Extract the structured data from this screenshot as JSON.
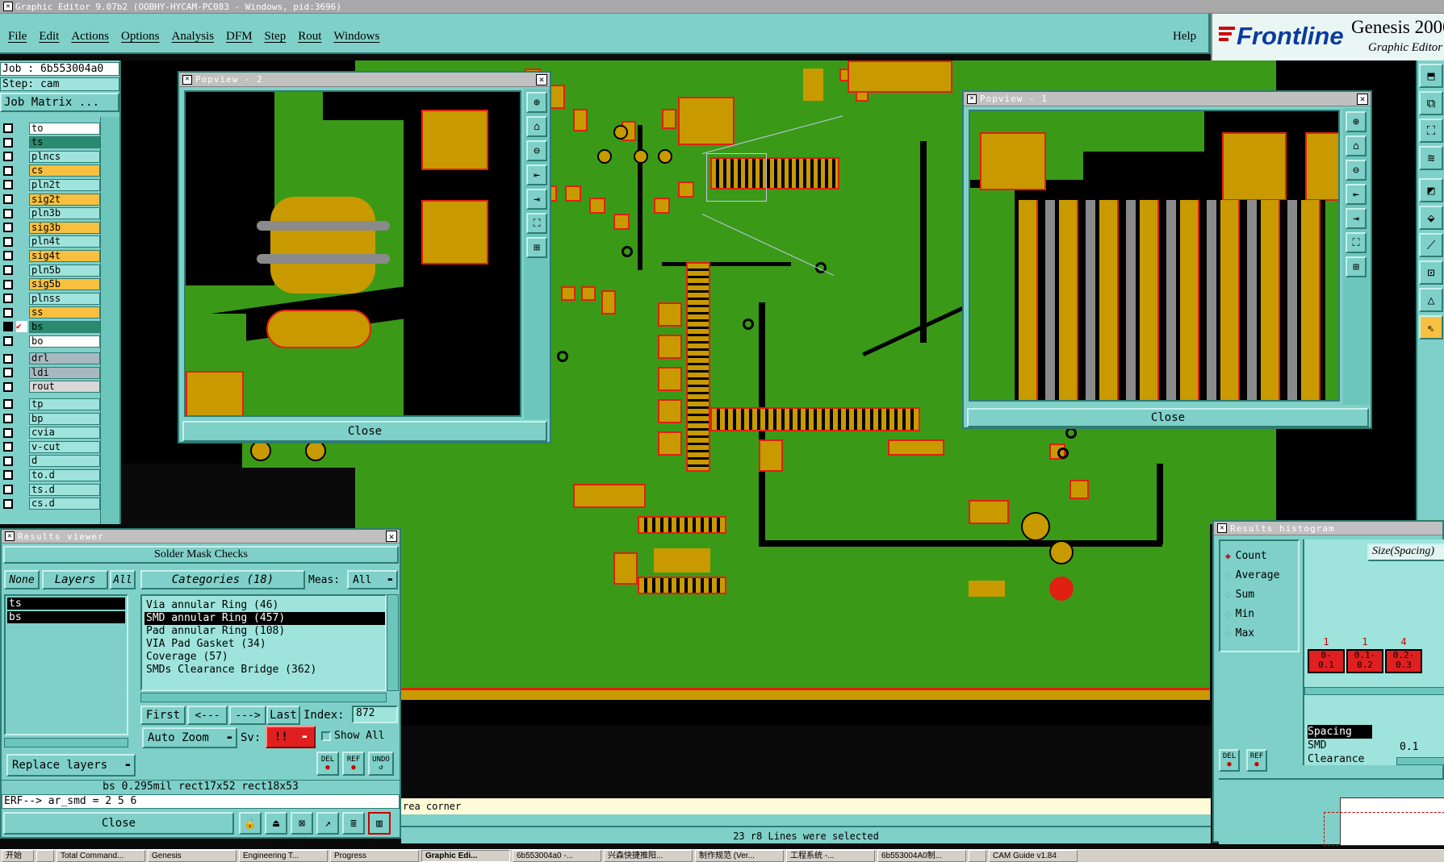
{
  "app": {
    "title": "Graphic Editor 9.07b2  (OOBHY-HYCAM-PC083 - Windows, pid:3696)",
    "brand": "Frontline",
    "product": "Genesis 2000",
    "product_sub": "Graphic Editor"
  },
  "menu": [
    "File",
    "Edit",
    "Actions",
    "Options",
    "Analysis",
    "DFM",
    "Step",
    "Rout",
    "Windows"
  ],
  "help": "Help",
  "job": {
    "job_label": "Job : 6b553004a0",
    "step_label": "Step: cam",
    "matrix_button": "Job Matrix ..."
  },
  "layers": [
    {
      "name": "to",
      "color": "#ffffff"
    },
    {
      "name": "ts",
      "color": "#2a8a70"
    },
    {
      "name": "plncs",
      "color": "#9ee4dc"
    },
    {
      "name": "cs",
      "color": "#f8c040"
    },
    {
      "name": "pln2t",
      "color": "#9ee4dc"
    },
    {
      "name": "sig2t",
      "color": "#f8c040"
    },
    {
      "name": "pln3b",
      "color": "#9ee4dc"
    },
    {
      "name": "sig3b",
      "color": "#f8c040"
    },
    {
      "name": "pln4t",
      "color": "#9ee4dc"
    },
    {
      "name": "sig4t",
      "color": "#f8c040"
    },
    {
      "name": "pln5b",
      "color": "#9ee4dc"
    },
    {
      "name": "sig5b",
      "color": "#f8c040"
    },
    {
      "name": "plnss",
      "color": "#9ee4dc"
    },
    {
      "name": "ss",
      "color": "#f8c040"
    },
    {
      "name": "bs",
      "color": "#2a8a70"
    },
    {
      "name": "bo",
      "color": "#ffffff"
    },
    {
      "name": "drl",
      "color": "#a8b8c0"
    },
    {
      "name": "ldi",
      "color": "#a8b8c0"
    },
    {
      "name": "rout",
      "color": "#d8d8d8"
    },
    {
      "name": "tp",
      "color": "#9ee4dc"
    },
    {
      "name": "bp",
      "color": "#9ee4dc"
    },
    {
      "name": "cvia",
      "color": "#9ee4dc"
    },
    {
      "name": "v-cut",
      "color": "#9ee4dc"
    },
    {
      "name": "d",
      "color": "#9ee4dc"
    },
    {
      "name": "to.d",
      "color": "#9ee4dc"
    },
    {
      "name": "ts.d",
      "color": "#9ee4dc"
    },
    {
      "name": "cs.d",
      "color": "#9ee4dc"
    }
  ],
  "popview2": {
    "title": "Popview - 2",
    "close": "Close"
  },
  "popview1": {
    "title": "Popview - 1",
    "close": "Close"
  },
  "results_viewer": {
    "title": "Results viewer",
    "header": "Solder Mask Checks",
    "none": "None",
    "layers": "Layers",
    "all": "All",
    "categories": "Categories (18)",
    "meas_label": "Meas:",
    "meas_value": "All",
    "layer_list": [
      "ts",
      "bs"
    ],
    "category_list": [
      "Via annular Ring (46)",
      "SMD annular Ring (457)",
      "Pad annular Ring (108)",
      "VIA Pad Gasket (34)",
      "Coverage (57)",
      "SMDs Clearance Bridge (362)"
    ],
    "first": "First",
    "prev": "<---",
    "next": "--->",
    "last": "Last",
    "index_label": "Index:",
    "index_value": "872",
    "auto_zoom": "Auto Zoom",
    "sv_label": "Sv:",
    "sv_value": "!!",
    "show_all": "Show All",
    "replace_layers": "Replace layers",
    "del": "DEL",
    "ref": "REF",
    "undo": "UNDO",
    "info": "bs 0.295mil   rect17x52   rect18x53",
    "erf": "ERF--> ar_smd = 2 5 6",
    "close": "Close"
  },
  "histogram": {
    "title": "Results histogram",
    "options": [
      "Count",
      "Average",
      "Sum",
      "Min",
      "Max"
    ],
    "size_label": "Size(Spacing)",
    "bar_counts": [
      "1",
      "1",
      "4"
    ],
    "bar_ranges": [
      "0-\n0.1",
      "0.1-\n0.2",
      "0.2-\n0.3"
    ],
    "legend": [
      "Spacing",
      "SMD",
      "Clearance"
    ],
    "value": "0.1",
    "del": "DEL",
    "ref": "REF"
  },
  "status": {
    "line1": "rea corner",
    "line2": "23 r8 Lines were selected"
  },
  "taskbar": [
    "开始",
    "",
    "Total Command...",
    "Genesis",
    "Engineering T...",
    "Progress",
    "Graphic Edi...",
    "6b553004a0 -...",
    "兴森快捷推阳...",
    "制作规范 (Ver...",
    "工程系统 -...",
    "6b553004A0制...",
    "",
    "CAM Guide v1.84"
  ]
}
